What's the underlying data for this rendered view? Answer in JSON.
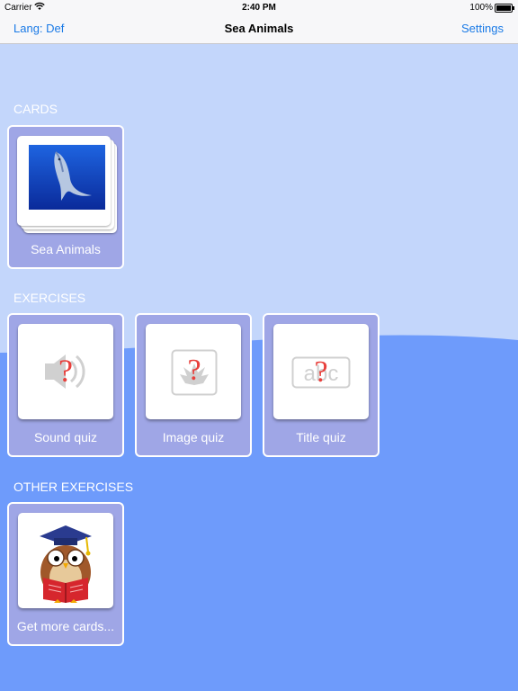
{
  "status_bar": {
    "carrier": "Carrier",
    "time": "2:40 PM",
    "battery": "100%"
  },
  "nav": {
    "left": "Lang: Def",
    "title": "Sea Animals",
    "right": "Settings"
  },
  "sections": {
    "cards": "CARDS",
    "exercises": "EXERCISES",
    "other": "OTHER EXERCISES"
  },
  "cards": [
    {
      "label": "Sea Animals",
      "icon": "dolphin-image"
    }
  ],
  "exercises": [
    {
      "label": "Sound quiz",
      "icon": "sound-quiz-icon"
    },
    {
      "label": "Image quiz",
      "icon": "image-quiz-icon"
    },
    {
      "label": "Title quiz",
      "icon": "title-quiz-icon",
      "icon_text": "abc"
    }
  ],
  "other_exercises": [
    {
      "label": "Get more cards...",
      "icon": "owl-reading-icon"
    }
  ],
  "colors": {
    "background_light": "#c3d6fb",
    "background_dark": "#6e9bfb",
    "tile": "#9fa6e6",
    "nav_link": "#1a7ae6",
    "question_mark": "#e8403c"
  }
}
